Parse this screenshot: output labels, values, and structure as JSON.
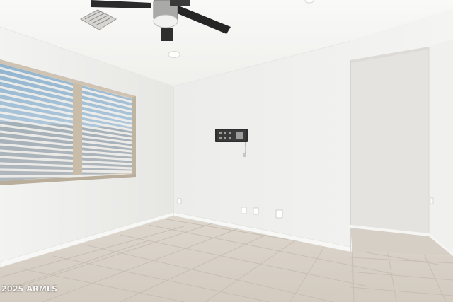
{
  "photo": {
    "watermark": "2025 ARMLS",
    "subject": "empty-room",
    "colors": {
      "wall_left": "#efefed",
      "wall_back": "#f1f1ef",
      "ceiling": "#f6f6f4",
      "hall_wall": "#e9e8e5",
      "floor_tile": "#d8d1c7",
      "grout": "#c7beb2",
      "baseboard": "#f4f4f2",
      "fan_blade": "#2a2a2a",
      "fan_housing": "#bdbdbd",
      "blind": "#e6e4df",
      "window_sky": "#a9c6dc",
      "window_frame": "#cbbfae"
    }
  }
}
